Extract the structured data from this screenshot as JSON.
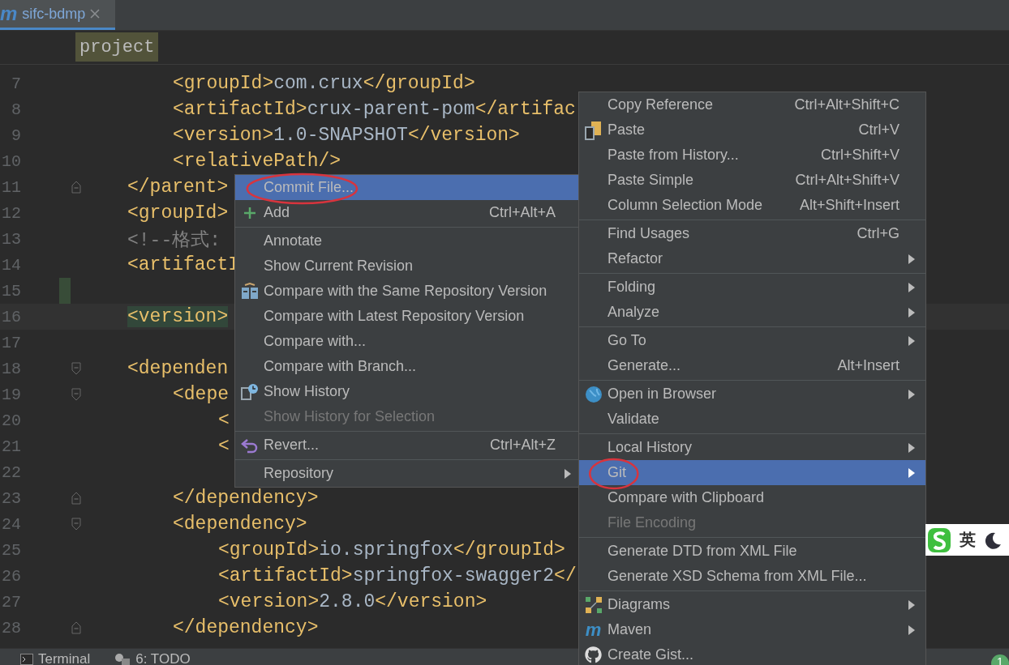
{
  "tab": {
    "icon_text": "m",
    "title": "sifc-bdmp"
  },
  "breadcrumb": "project",
  "lines": [
    {
      "children": [
        {
          "number": "7",
          "code": "<groupId>com.crux</groupId>"
        },
        {
          "number": "8",
          "code": "<artifactId>crux-parent-pom</artifac"
        },
        {
          "number": "9",
          "code": "<version>1.0-SNAPSHOT</version>"
        },
        {
          "number": "10",
          "code": "<relativePath/>"
        }
      ]
    },
    {
      "number": "11",
      "kind": "fold-end",
      "code": "</parent>"
    },
    {
      "number": "12",
      "code": "<groupId>"
    },
    {
      "number": "13",
      "code": "<!--格式:"
    },
    {
      "number": "14",
      "code": "<artifactI"
    },
    {
      "number": "15",
      "changed": true
    },
    {
      "number": "16",
      "code": "<version>",
      "current": true
    },
    {
      "number": "17"
    },
    {
      "number": "18",
      "kind": "fold-start",
      "code": "<dependen",
      "children": [
        {
          "number": "19",
          "kind": "fold-start",
          "code": "<depe",
          "children": [
            {
              "number": "20",
              "code": "<"
            },
            {
              "number": "21",
              "code": "<"
            },
            {
              "number": "22"
            }
          ]
        },
        {
          "number": "23",
          "kind": "fold-end",
          "code": "</dependency>"
        },
        {
          "number": "24",
          "kind": "fold-start",
          "code": "<dependency>",
          "children": [
            {
              "number": "25",
              "code": "<groupId>io.springfox</groupId>"
            },
            {
              "number": "26",
              "code": "<artifactId>springfox-swagger2</"
            },
            {
              "number": "27",
              "code": "<version>2.8.0</version>"
            }
          ]
        },
        {
          "number": "28",
          "kind": "fold-end",
          "code": "</dependency>"
        }
      ]
    }
  ],
  "git_menu": [
    {
      "kind": "plain",
      "label": "Commit File...",
      "selected": true,
      "disabled": false,
      "circled": true
    },
    {
      "kind": "add",
      "label": "Add",
      "shortcut": "Ctrl+Alt+A",
      "selected": false,
      "disabled": false
    },
    {
      "kind": "separator"
    },
    {
      "kind": "plain",
      "label": "Annotate",
      "selected": false,
      "disabled": false
    },
    {
      "kind": "plain",
      "label": "Show Current Revision",
      "selected": false,
      "disabled": false
    },
    {
      "kind": "compare",
      "label": "Compare with the Same Repository Version",
      "selected": false,
      "disabled": false
    },
    {
      "kind": "plain",
      "label": "Compare with Latest Repository Version",
      "selected": false,
      "disabled": false
    },
    {
      "kind": "plain",
      "label": "Compare with...",
      "selected": false,
      "disabled": false
    },
    {
      "kind": "plain",
      "label": "Compare with Branch...",
      "selected": false,
      "disabled": false
    },
    {
      "kind": "history",
      "label": "Show History",
      "selected": false,
      "disabled": false
    },
    {
      "kind": "plain",
      "label": "Show History for Selection",
      "selected": false,
      "disabled": true
    },
    {
      "kind": "separator"
    },
    {
      "kind": "revert",
      "label": "Revert...",
      "shortcut": "Ctrl+Alt+Z",
      "selected": false,
      "disabled": false
    },
    {
      "kind": "separator"
    },
    {
      "kind": "plain",
      "label": "Repository",
      "selected": false,
      "disabled": false,
      "submenu": true
    }
  ],
  "context_menu": [
    {
      "kind": "plain",
      "label": "Copy Reference",
      "shortcut": "Ctrl+Alt+Shift+C",
      "selected": false,
      "disabled": false
    },
    {
      "kind": "paste",
      "label": "Paste",
      "shortcut": "Ctrl+V",
      "selected": false,
      "disabled": false
    },
    {
      "kind": "plain",
      "label": "Paste from History...",
      "shortcut": "Ctrl+Shift+V",
      "selected": false,
      "disabled": false
    },
    {
      "kind": "plain",
      "label": "Paste Simple",
      "shortcut": "Ctrl+Alt+Shift+V",
      "selected": false,
      "disabled": false
    },
    {
      "kind": "plain",
      "label": "Column Selection Mode",
      "shortcut": "Alt+Shift+Insert",
      "selected": false,
      "disabled": false
    },
    {
      "kind": "separator"
    },
    {
      "kind": "plain",
      "label": "Find Usages",
      "shortcut": "Ctrl+G",
      "selected": false,
      "disabled": false
    },
    {
      "kind": "plain",
      "label": "Refactor",
      "selected": false,
      "disabled": false,
      "submenu": true
    },
    {
      "kind": "separator"
    },
    {
      "kind": "plain",
      "label": "Folding",
      "selected": false,
      "disabled": false,
      "submenu": true
    },
    {
      "kind": "plain",
      "label": "Analyze",
      "selected": false,
      "disabled": false,
      "submenu": true
    },
    {
      "kind": "separator"
    },
    {
      "kind": "plain",
      "label": "Go To",
      "selected": false,
      "disabled": false,
      "submenu": true
    },
    {
      "kind": "plain",
      "label": "Generate...",
      "shortcut": "Alt+Insert",
      "selected": false,
      "disabled": false
    },
    {
      "kind": "separator"
    },
    {
      "kind": "globe",
      "label": "Open in Browser",
      "selected": false,
      "disabled": false,
      "submenu": true
    },
    {
      "kind": "plain",
      "label": "Validate",
      "selected": false,
      "disabled": false
    },
    {
      "kind": "separator"
    },
    {
      "kind": "plain",
      "label": "Local History",
      "selected": false,
      "disabled": false,
      "submenu": true
    },
    {
      "kind": "plain",
      "label": "Git",
      "selected": true,
      "disabled": false,
      "circled": true,
      "submenu": true
    },
    {
      "kind": "plain",
      "label": "Compare with Clipboard",
      "selected": false,
      "disabled": false
    },
    {
      "kind": "plain",
      "label": "File Encoding",
      "selected": false,
      "disabled": true
    },
    {
      "kind": "separator"
    },
    {
      "kind": "plain",
      "label": "Generate DTD from XML File",
      "selected": false,
      "disabled": false
    },
    {
      "kind": "plain",
      "label": "Generate XSD Schema from XML File...",
      "selected": false,
      "disabled": false
    },
    {
      "kind": "separator"
    },
    {
      "kind": "diagram",
      "label": "Diagrams",
      "selected": false,
      "disabled": false,
      "submenu": true
    },
    {
      "kind": "maven",
      "icon_text": "m",
      "label": "Maven",
      "selected": false,
      "disabled": false,
      "submenu": true
    },
    {
      "kind": "github",
      "label": "Create Gist...",
      "selected": false,
      "disabled": false
    }
  ],
  "tool_windows": [
    {
      "kind": "terminal",
      "label": "Terminal"
    },
    {
      "kind": "todo",
      "label": "6: TODO"
    }
  ],
  "ime_bar": {
    "label": "英"
  },
  "notification_badge": "1"
}
